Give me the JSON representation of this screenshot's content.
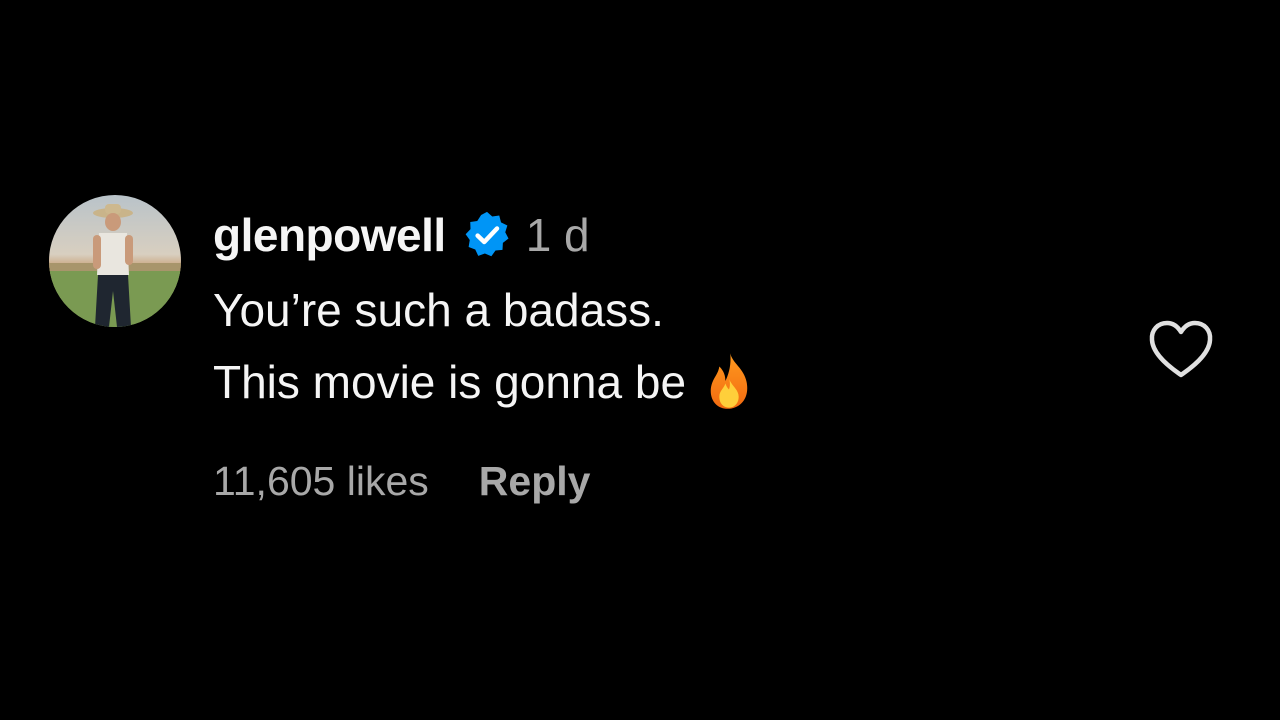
{
  "comment": {
    "username": "glenpowell",
    "verified": true,
    "verified_icon": "verified-badge-icon",
    "timestamp": "1 d",
    "lines": [
      "You’re such a badass.",
      "This movie is gonna be"
    ],
    "emoji": "fire-emoji",
    "likes": "11,605 likes",
    "reply_label": "Reply",
    "like_icon": "heart-outline-icon"
  },
  "colors": {
    "background": "#000000",
    "primary_text": "#f5f5f5",
    "secondary_text": "#a8a8a8",
    "verified_blue": "#0095f6"
  }
}
